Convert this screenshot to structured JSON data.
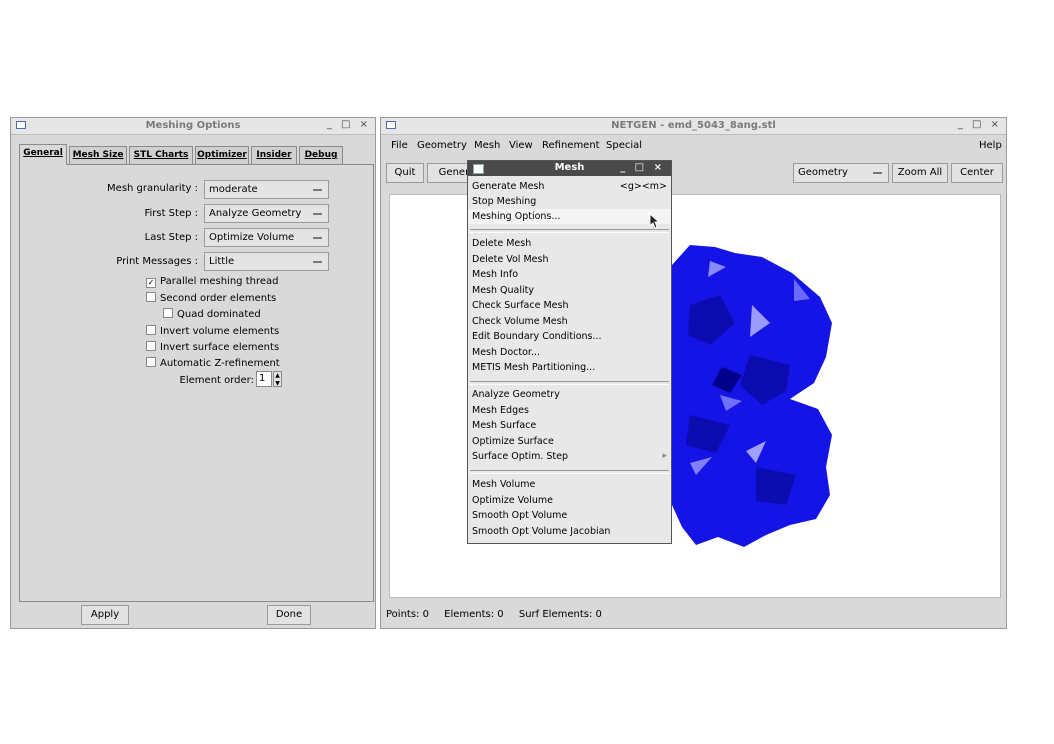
{
  "options_window": {
    "title": "Meshing Options",
    "controls": "_ □ ×",
    "tabs": [
      "General",
      "Mesh Size",
      "STL Charts",
      "Optimizer",
      "Insider",
      "Debug"
    ],
    "fields": {
      "granularity": {
        "label": "Mesh granularity :",
        "value": "moderate"
      },
      "first_step": {
        "label": "First Step :",
        "value": "Analyze Geometry"
      },
      "last_step": {
        "label": "Last Step :",
        "value": "Optimize Volume"
      },
      "print_messages": {
        "label": "Print Messages :",
        "value": "Little"
      }
    },
    "checkboxes": [
      {
        "label": "Parallel meshing thread",
        "checked": true
      },
      {
        "label": "Second order elements",
        "checked": false
      },
      {
        "label": "Quad dominated",
        "checked": false
      },
      {
        "label": "Invert volume elements",
        "checked": false
      },
      {
        "label": "Invert surface elements",
        "checked": false
      },
      {
        "label": "Automatic Z-refinement",
        "checked": false
      }
    ],
    "element_order": {
      "label": "Element order:",
      "value": "1"
    },
    "apply": "Apply",
    "done": "Done"
  },
  "netgen_window": {
    "title": "NETGEN - emd_5043_8ang.stl",
    "controls": "_ □ ×",
    "menubar": [
      "File",
      "Geometry",
      "Mesh",
      "View",
      "Refinement",
      "Special"
    ],
    "help": "Help",
    "toolbar": {
      "quit": "Quit",
      "generate": "Genera",
      "geometry_select": "Geometry",
      "zoom_all": "Zoom All",
      "center": "Center"
    },
    "status": {
      "points": "Points: 0",
      "elements": "Elements: 0",
      "surf_elements": "Surf Elements: 0"
    },
    "mesh_color": "#1010e0"
  },
  "mesh_menu": {
    "title": "Mesh",
    "controls": "_ □ ×",
    "groups": [
      [
        {
          "label": "Generate Mesh",
          "shortcut": "<g><m>"
        },
        {
          "label": "Stop Meshing",
          "shortcut": ""
        },
        {
          "label": "Meshing Options...",
          "shortcut": ""
        }
      ],
      [
        {
          "label": "Delete Mesh",
          "shortcut": ""
        },
        {
          "label": "Delete Vol Mesh",
          "shortcut": ""
        },
        {
          "label": "Mesh Info",
          "shortcut": ""
        },
        {
          "label": "Mesh Quality",
          "shortcut": ""
        },
        {
          "label": "Check Surface Mesh",
          "shortcut": ""
        },
        {
          "label": "Check Volume Mesh",
          "shortcut": ""
        },
        {
          "label": "Edit Boundary Conditions...",
          "shortcut": ""
        },
        {
          "label": "Mesh Doctor...",
          "shortcut": ""
        },
        {
          "label": "METIS Mesh Partitioning...",
          "shortcut": ""
        }
      ],
      [
        {
          "label": "Analyze Geometry",
          "shortcut": ""
        },
        {
          "label": "Mesh Edges",
          "shortcut": ""
        },
        {
          "label": "Mesh Surface",
          "shortcut": ""
        },
        {
          "label": "Optimize Surface",
          "shortcut": ""
        },
        {
          "label": "Surface Optim. Step",
          "shortcut": "▸"
        }
      ],
      [
        {
          "label": "Mesh Volume",
          "shortcut": ""
        },
        {
          "label": "Optimize Volume",
          "shortcut": ""
        },
        {
          "label": "Smooth Opt Volume",
          "shortcut": ""
        },
        {
          "label": "Smooth Opt Volume Jacobian",
          "shortcut": ""
        }
      ]
    ]
  }
}
